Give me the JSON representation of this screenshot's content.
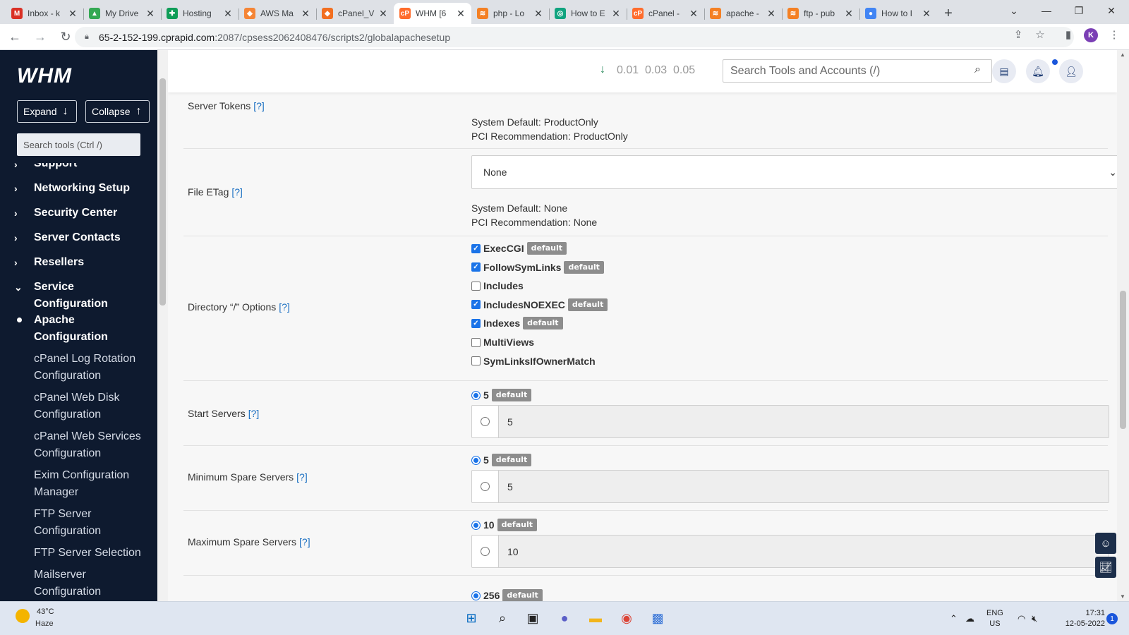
{
  "browser": {
    "tabs": [
      {
        "title": "Inbox - k",
        "icon": "gmail-icon",
        "color": "#d93025",
        "glyph": "M"
      },
      {
        "title": "My Drive",
        "icon": "drive-icon",
        "color": "#34a853",
        "glyph": "▲"
      },
      {
        "title": "Hosting",
        "icon": "sheets-icon",
        "color": "#0f9d58",
        "glyph": "✚"
      },
      {
        "title": "AWS Ma",
        "icon": "aws-icon",
        "color": "#f58536",
        "glyph": "◆"
      },
      {
        "title": "cPanel_V",
        "icon": "cpanel-icon",
        "color": "#f26f21",
        "glyph": "◆"
      },
      {
        "title": "WHM [6",
        "icon": "cpanel-logo-icon",
        "color": "#ff6c2c",
        "glyph": "cP"
      },
      {
        "title": "php - Lo",
        "icon": "stackoverflow-icon",
        "color": "#f48024",
        "glyph": "≋"
      },
      {
        "title": "How to E",
        "icon": "chatgpt-icon",
        "color": "#10a37f",
        "glyph": "◎"
      },
      {
        "title": "cPanel -",
        "icon": "cpanel-logo-icon",
        "color": "#ff6c2c",
        "glyph": "cP"
      },
      {
        "title": "apache -",
        "icon": "stackoverflow-icon",
        "color": "#f48024",
        "glyph": "≋"
      },
      {
        "title": "ftp - pub",
        "icon": "stackoverflow-icon",
        "color": "#f48024",
        "glyph": "≋"
      },
      {
        "title": "How to I",
        "icon": "globe-icon",
        "color": "#4285f4",
        "glyph": "●"
      }
    ],
    "active_tab": 5,
    "url_host": "65-2-152-199.cprapid.com",
    "url_path": ":2087/cpsess2062408476/scripts2/globalapachesetup",
    "profile_initial": "K"
  },
  "sidebar": {
    "logo": "WHM",
    "expand_label": "Expand",
    "collapse_label": "Collapse",
    "search_placeholder": "Search tools (Ctrl /)",
    "partial_item": "Support",
    "categories": [
      {
        "label": "Networking Setup"
      },
      {
        "label": "Security Center"
      },
      {
        "label": "Server Contacts"
      },
      {
        "label": "Resellers"
      },
      {
        "label": "Service Configuration"
      }
    ],
    "subitems": [
      {
        "label": "Apache Configuration",
        "current": true
      },
      {
        "label": "cPanel Log Rotation Configuration"
      },
      {
        "label": "cPanel Web Disk Configuration"
      },
      {
        "label": "cPanel Web Services Configuration"
      },
      {
        "label": "Exim Configuration Manager"
      },
      {
        "label": "FTP Server Configuration"
      },
      {
        "label": "FTP Server Selection"
      },
      {
        "label": "Mailserver Configuration"
      }
    ]
  },
  "header": {
    "load_values": [
      "0.01",
      "0.03",
      "0.05"
    ],
    "search_placeholder": "Search Tools and Accounts (/)"
  },
  "settings": {
    "help_label": "[?]",
    "default_badge": "default",
    "server_tokens": {
      "label": "Server Tokens",
      "system_default": "System Default: ProductOnly",
      "pci_recommendation": "PCI Recommendation: ProductOnly"
    },
    "file_etag": {
      "label": "File ETag",
      "selected": "None",
      "system_default": "System Default: None",
      "pci_recommendation": "PCI Recommendation: None"
    },
    "directory_options": {
      "label": "Directory “/” Options",
      "options": [
        {
          "name": "ExecCGI",
          "checked": true,
          "is_default": true
        },
        {
          "name": "FollowSymLinks",
          "checked": true,
          "is_default": true
        },
        {
          "name": "Includes",
          "checked": false,
          "is_default": false
        },
        {
          "name": "IncludesNOEXEC",
          "checked": true,
          "is_default": true
        },
        {
          "name": "Indexes",
          "checked": true,
          "is_default": true
        },
        {
          "name": "MultiViews",
          "checked": false,
          "is_default": false
        },
        {
          "name": "SymLinksIfOwnerMatch",
          "checked": false,
          "is_default": false
        }
      ]
    },
    "start_servers": {
      "label": "Start Servers",
      "default_value": "5",
      "custom_value": "5"
    },
    "min_spare_servers": {
      "label": "Minimum Spare Servers",
      "default_value": "5",
      "custom_value": "5"
    },
    "max_spare_servers": {
      "label": "Maximum Spare Servers",
      "default_value": "10",
      "custom_value": "10"
    },
    "next_default_value": "256"
  },
  "taskbar": {
    "temperature": "43°C",
    "weather": "Haze",
    "lang_line1": "ENG",
    "lang_line2": "US",
    "time": "17:31",
    "date": "12-05-2022",
    "notification_count": "1"
  }
}
